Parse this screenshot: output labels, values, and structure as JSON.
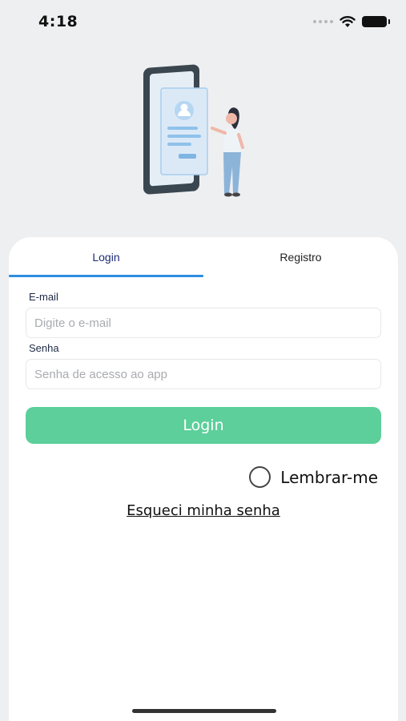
{
  "status_bar": {
    "time": "4:18",
    "icons": [
      "signal-dots-icon",
      "wifi-icon",
      "battery-icon"
    ]
  },
  "tabs": [
    {
      "label": "Login",
      "active": true
    },
    {
      "label": "Registro",
      "active": false
    }
  ],
  "form": {
    "email_label": "E-mail",
    "email_placeholder": "Digite o e-mail",
    "email_value": "",
    "password_label": "Senha",
    "password_placeholder": "Senha de acesso ao app",
    "password_value": "",
    "submit_label": "Login",
    "remember_label": "Lembrar-me",
    "remember_checked": false,
    "forgot_label": "Esqueci minha senha"
  },
  "colors": {
    "background": "#eeeff1",
    "accent_button": "#5ccf9a",
    "tab_indicator": "#2f8ee0",
    "active_tab_text": "#1e2b73"
  }
}
